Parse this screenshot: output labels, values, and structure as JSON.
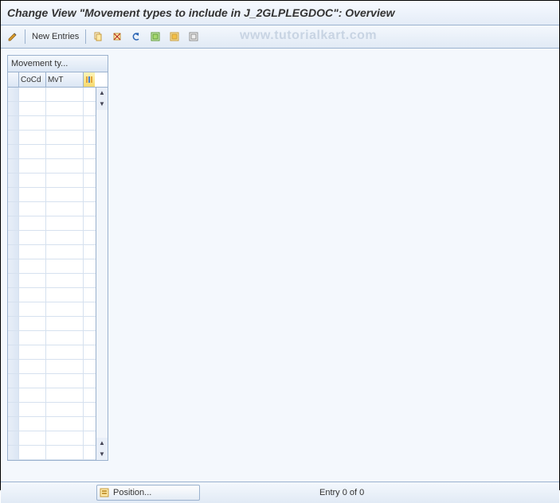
{
  "title": "Change View \"Movement types to include in J_2GLPLEGDOC\": Overview",
  "toolbar": {
    "new_entries": "New Entries"
  },
  "watermark": "www.tutorialkart.com",
  "table": {
    "title": "Movement ty...",
    "columns": {
      "c1": "CoCd",
      "c2": "MvT"
    },
    "rows": [
      "",
      "",
      "",
      "",
      "",
      "",
      "",
      "",
      "",
      "",
      "",
      "",
      "",
      "",
      "",
      "",
      "",
      "",
      "",
      "",
      "",
      "",
      "",
      "",
      "",
      ""
    ]
  },
  "footer": {
    "position_btn": "Position...",
    "entry_status": "Entry 0 of 0"
  }
}
